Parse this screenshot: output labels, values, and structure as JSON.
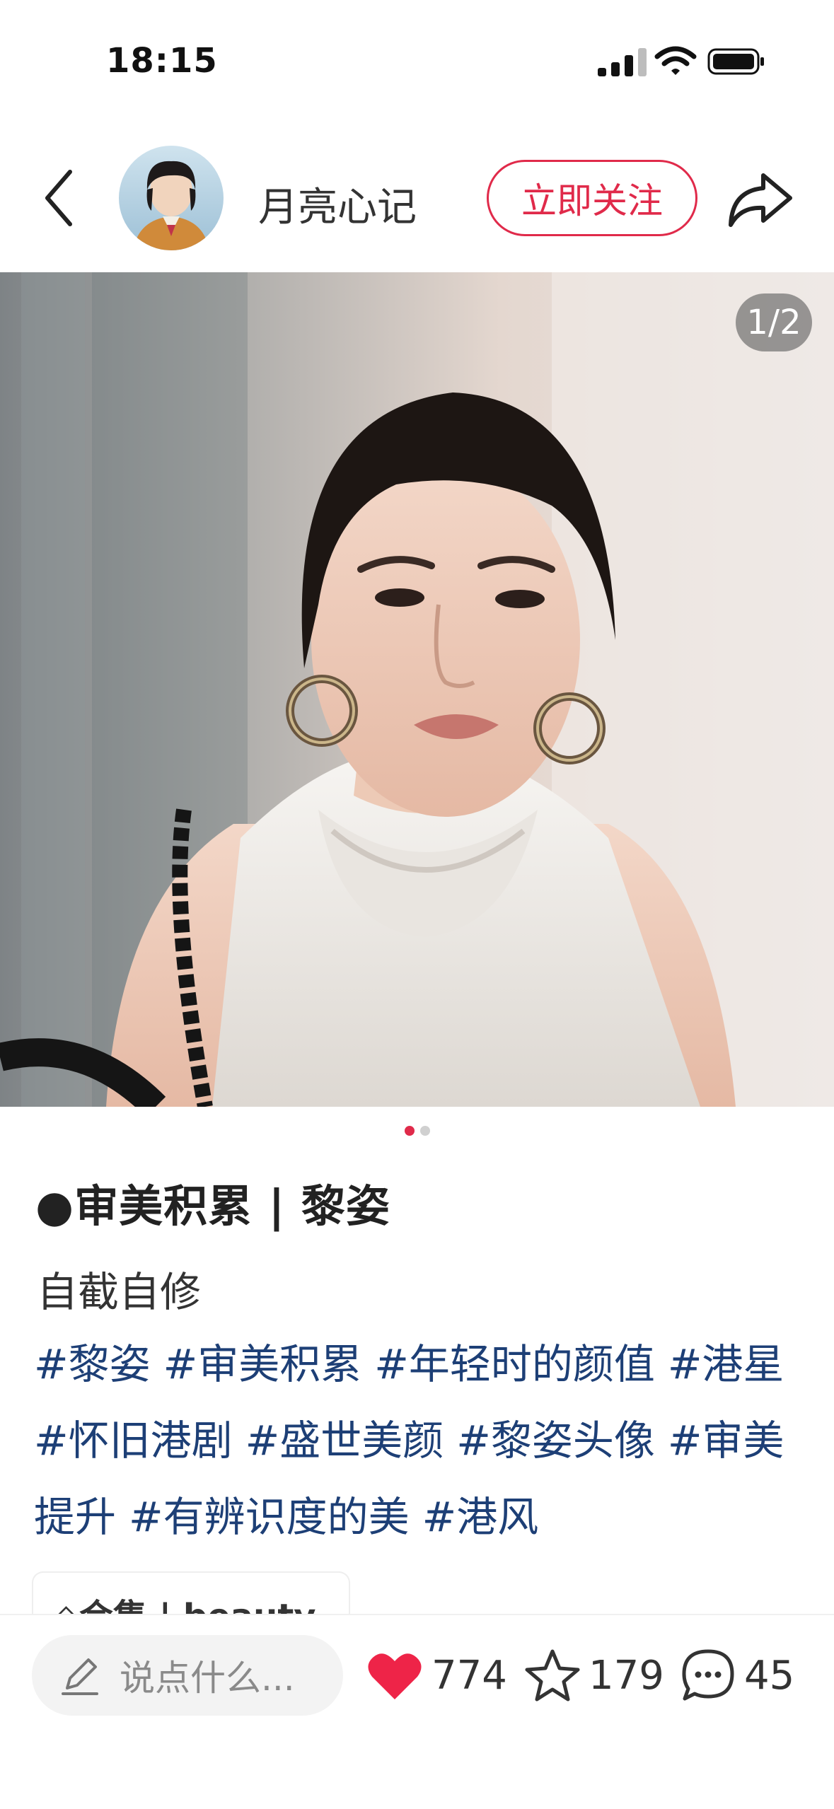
{
  "status_bar": {
    "time": "18:15"
  },
  "header": {
    "author_name": "月亮心记",
    "follow_label": "立即关注"
  },
  "carousel": {
    "page_counter": "1/2",
    "current_page": 1,
    "total_pages": 2
  },
  "note": {
    "title": "●审美积累 | 黎姿",
    "description": "自截自修",
    "tags": [
      "#黎姿",
      "#审美积累",
      "#年轻时的颜值",
      "#港星",
      "#怀旧港剧",
      "#盛世美颜",
      "#黎姿头像",
      "#审美提升",
      "#有辨识度的美",
      "#港风"
    ],
    "collection_label": "◇合集 | beauty"
  },
  "bottom_bar": {
    "comment_placeholder": "说点什么...",
    "likes": "774",
    "favorites": "179",
    "comments": "45"
  },
  "colors": {
    "accent": "#e02a4a",
    "tag": "#1d3f76",
    "heart": "#ee2448"
  },
  "icons": [
    "back-arrow-icon",
    "share-arrow-icon",
    "pencil-icon",
    "heart-icon",
    "star-icon",
    "comment-bubble-icon",
    "signal-icon",
    "wifi-icon",
    "battery-icon"
  ]
}
